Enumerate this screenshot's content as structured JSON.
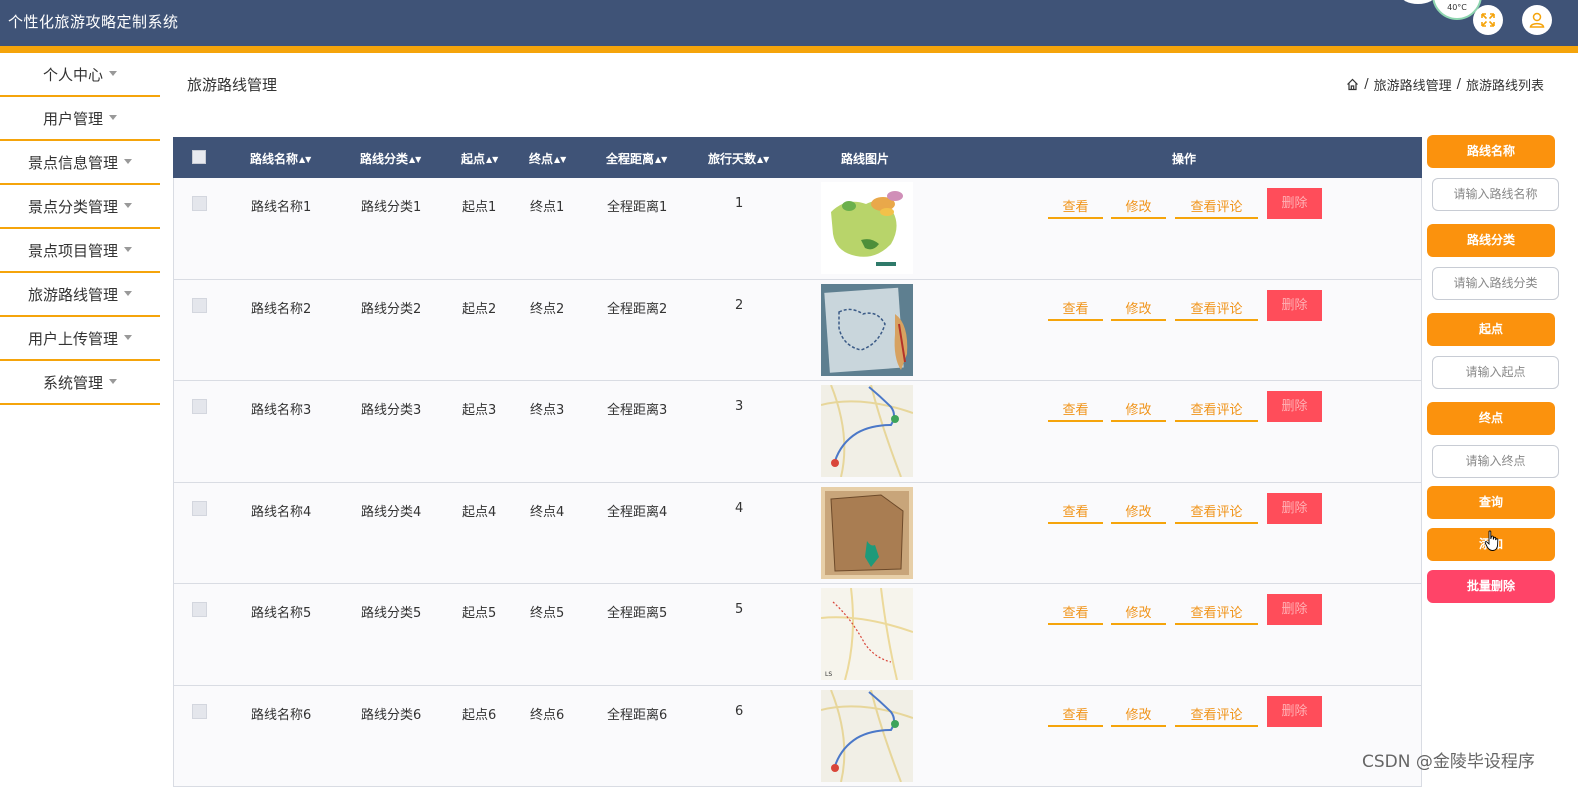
{
  "app": {
    "title": "个性化旅游攻略定制系统",
    "weather": "40°C"
  },
  "sidebar": {
    "items": [
      {
        "label": "个人中心"
      },
      {
        "label": "用户管理"
      },
      {
        "label": "景点信息管理"
      },
      {
        "label": "景点分类管理"
      },
      {
        "label": "景点项目管理"
      },
      {
        "label": "旅游路线管理"
      },
      {
        "label": "用户上传管理"
      },
      {
        "label": "系统管理"
      }
    ]
  },
  "page": {
    "title": "旅游路线管理",
    "breadcrumb": [
      "旅游路线管理",
      "旅游路线列表"
    ],
    "breadcrumb_sep": "/"
  },
  "table": {
    "headers": {
      "name": "路线名称",
      "category": "路线分类",
      "start": "起点",
      "end": "终点",
      "distance": "全程距离",
      "days": "旅行天数",
      "image": "路线图片",
      "ops": "操作"
    },
    "actions": {
      "view": "查看",
      "edit": "修改",
      "comments": "查看评论",
      "delete": "删除"
    },
    "rows": [
      {
        "name": "路线名称1",
        "category": "路线分类1",
        "start": "起点1",
        "end": "终点1",
        "distance": "全程距离1",
        "days": "1"
      },
      {
        "name": "路线名称2",
        "category": "路线分类2",
        "start": "起点2",
        "end": "终点2",
        "distance": "全程距离2",
        "days": "2"
      },
      {
        "name": "路线名称3",
        "category": "路线分类3",
        "start": "起点3",
        "end": "终点3",
        "distance": "全程距离3",
        "days": "3"
      },
      {
        "name": "路线名称4",
        "category": "路线分类4",
        "start": "起点4",
        "end": "终点4",
        "distance": "全程距离4",
        "days": "4"
      },
      {
        "name": "路线名称5",
        "category": "路线分类5",
        "start": "起点5",
        "end": "终点5",
        "distance": "全程距离5",
        "days": "5"
      },
      {
        "name": "路线名称6",
        "category": "路线分类6",
        "start": "起点6",
        "end": "终点6",
        "distance": "全程距离6",
        "days": "6"
      }
    ]
  },
  "search": {
    "name_label": "路线名称",
    "name_placeholder": "请输入路线名称",
    "category_label": "路线分类",
    "category_placeholder": "请输入路线分类",
    "start_label": "起点",
    "start_placeholder": "请输入起点",
    "end_label": "终点",
    "end_placeholder": "请输入终点",
    "query_button": "查询",
    "add_button": "添加",
    "batch_delete_button": "批量删除"
  },
  "watermark": "CSDN @金陵毕设程序",
  "colors": {
    "header": "#3f5377",
    "accent": "#f5a40b",
    "button_orange": "#fb920d",
    "danger": "#ff4d5a"
  }
}
